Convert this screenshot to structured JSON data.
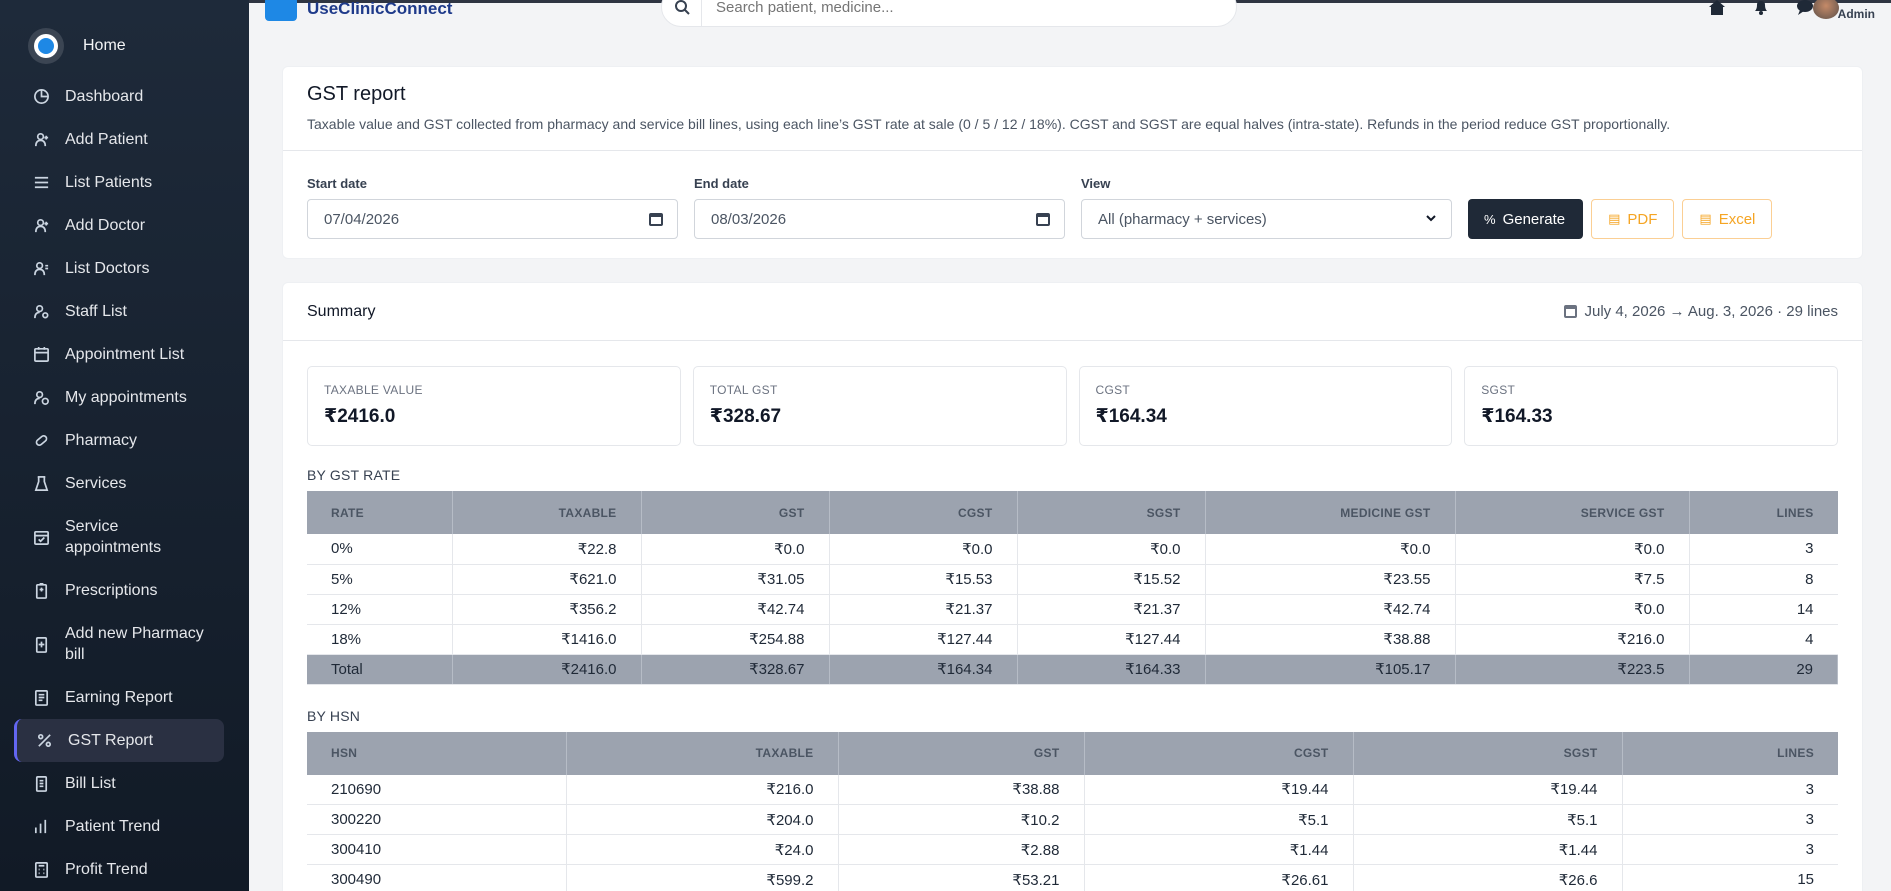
{
  "sidebar": {
    "home_label": "Home",
    "items": [
      {
        "label": "Dashboard",
        "icon": "pie-chart-icon"
      },
      {
        "label": "Add Patient",
        "icon": "user-plus-icon"
      },
      {
        "label": "List Patients",
        "icon": "list-icon"
      },
      {
        "label": "Add Doctor",
        "icon": "user-plus-icon"
      },
      {
        "label": "List Doctors",
        "icon": "users-icon"
      },
      {
        "label": "Staff List",
        "icon": "user-gear-icon"
      },
      {
        "label": "Appointment List",
        "icon": "calendar-icon"
      },
      {
        "label": "My appointments",
        "icon": "user-clock-icon"
      },
      {
        "label": "Pharmacy",
        "icon": "pill-icon"
      },
      {
        "label": "Services",
        "icon": "flask-icon"
      },
      {
        "label": "Service appointments",
        "icon": "calendar-check-icon"
      },
      {
        "label": "Prescriptions",
        "icon": "clipboard-icon"
      },
      {
        "label": "Add new Pharmacy bill",
        "icon": "receipt-plus-icon"
      },
      {
        "label": "Earning Report",
        "icon": "report-icon"
      },
      {
        "label": "GST Report",
        "icon": "percent-icon"
      },
      {
        "label": "Bill List",
        "icon": "bill-icon"
      },
      {
        "label": "Patient Trend",
        "icon": "bar-chart-icon"
      },
      {
        "label": "Profit Trend",
        "icon": "calculator-icon"
      }
    ]
  },
  "topbar": {
    "brand": "UseClinicConnect",
    "search_placeholder": "Search patient, medicine...",
    "user_role": "Admin"
  },
  "report": {
    "title": "GST report",
    "description": "Taxable value and GST collected from pharmacy and service bill lines, using each line’s GST rate at sale (0 / 5 / 12 / 18%). CGST and SGST are equal halves (intra-state). Refunds in the period reduce GST proportionally.",
    "start_label": "Start date",
    "start_value": "07/04/2026",
    "end_label": "End date",
    "end_value": "08/03/2026",
    "view_label": "View",
    "view_value": "All (pharmacy + services)",
    "generate_label": "Generate",
    "pdf_label": "PDF",
    "excel_label": "Excel"
  },
  "summary": {
    "title": "Summary",
    "range": "July 4, 2026 → Aug. 3, 2026 · 29 lines",
    "kpis": [
      {
        "label": "TAXABLE VALUE",
        "value": "₹2416.0"
      },
      {
        "label": "TOTAL GST",
        "value": "₹328.67"
      },
      {
        "label": "CGST",
        "value": "₹164.34"
      },
      {
        "label": "SGST",
        "value": "₹164.33"
      }
    ]
  },
  "by_rate": {
    "title": "BY GST RATE",
    "headers": [
      "RATE",
      "TAXABLE",
      "GST",
      "CGST",
      "SGST",
      "MEDICINE GST",
      "SERVICE GST",
      "LINES"
    ],
    "rows": [
      [
        "0%",
        "₹22.8",
        "₹0.0",
        "₹0.0",
        "₹0.0",
        "₹0.0",
        "₹0.0",
        "3"
      ],
      [
        "5%",
        "₹621.0",
        "₹31.05",
        "₹15.53",
        "₹15.52",
        "₹23.55",
        "₹7.5",
        "8"
      ],
      [
        "12%",
        "₹356.2",
        "₹42.74",
        "₹21.37",
        "₹21.37",
        "₹42.74",
        "₹0.0",
        "14"
      ],
      [
        "18%",
        "₹1416.0",
        "₹254.88",
        "₹127.44",
        "₹127.44",
        "₹38.88",
        "₹216.0",
        "4"
      ]
    ],
    "total": [
      "Total",
      "₹2416.0",
      "₹328.67",
      "₹164.34",
      "₹164.33",
      "₹105.17",
      "₹223.5",
      "29"
    ]
  },
  "by_hsn": {
    "title": "BY HSN",
    "headers": [
      "HSN",
      "TAXABLE",
      "GST",
      "CGST",
      "SGST",
      "LINES"
    ],
    "rows": [
      [
        "210690",
        "₹216.0",
        "₹38.88",
        "₹19.44",
        "₹19.44",
        "3"
      ],
      [
        "300220",
        "₹204.0",
        "₹10.2",
        "₹5.1",
        "₹5.1",
        "3"
      ],
      [
        "300410",
        "₹24.0",
        "₹2.88",
        "₹1.44",
        "₹1.44",
        "3"
      ],
      [
        "300490",
        "₹599.2",
        "₹53.21",
        "₹26.61",
        "₹26.6",
        "15"
      ]
    ]
  }
}
